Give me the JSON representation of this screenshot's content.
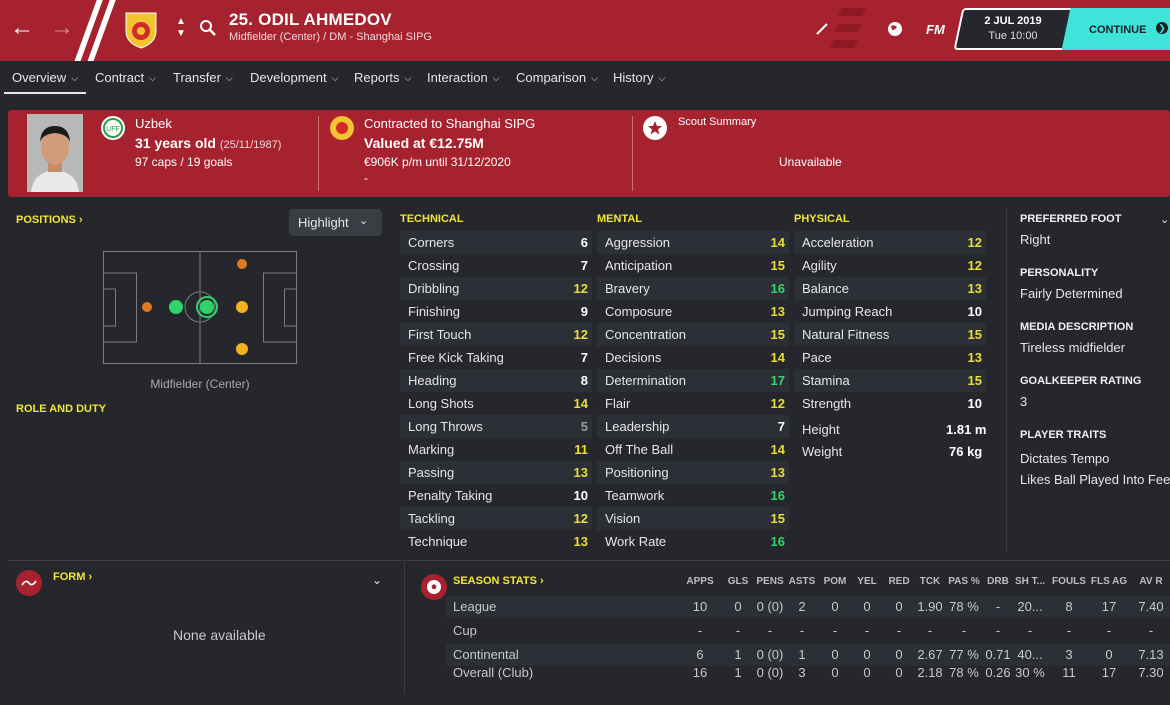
{
  "header": {
    "player_name": "25. ODIL AHMEDOV",
    "player_subtitle": "Midfielder (Center) / DM - Shanghai SIPG",
    "logo": "FM",
    "date": "2 JUL 2019",
    "day_time": "Tue 10:00",
    "continue_label": "CONTINUE"
  },
  "tabs": [
    {
      "label": "Overview"
    },
    {
      "label": "Contract"
    },
    {
      "label": "Transfer"
    },
    {
      "label": "Development"
    },
    {
      "label": "Reports"
    },
    {
      "label": "Interaction"
    },
    {
      "label": "Comparison"
    },
    {
      "label": "History"
    }
  ],
  "banner": {
    "nationality": "Uzbek",
    "age": "31 years old",
    "dob": "(25/11/1987)",
    "caps": "97 caps / 19 goals",
    "contract": "Contracted to Shanghai SIPG",
    "value": "Valued at €12.75M",
    "wage": "€906K p/m until 31/12/2020",
    "dash": "-",
    "scout_title": "Scout Summary",
    "scout_value": "Unavailable"
  },
  "left": {
    "positions_label": "POSITIONS",
    "highlight_label": "Highlight",
    "position_name": "Midfielder (Center)",
    "role_label": "ROLE AND DUTY"
  },
  "attributes": {
    "technical": {
      "title": "TECHNICAL",
      "rows": [
        {
          "name": "Corners",
          "value": "6"
        },
        {
          "name": "Crossing",
          "value": "7"
        },
        {
          "name": "Dribbling",
          "value": "12"
        },
        {
          "name": "Finishing",
          "value": "9"
        },
        {
          "name": "First Touch",
          "value": "12"
        },
        {
          "name": "Free Kick Taking",
          "value": "7"
        },
        {
          "name": "Heading",
          "value": "8"
        },
        {
          "name": "Long Shots",
          "value": "14"
        },
        {
          "name": "Long Throws",
          "value": "5"
        },
        {
          "name": "Marking",
          "value": "11"
        },
        {
          "name": "Passing",
          "value": "13"
        },
        {
          "name": "Penalty Taking",
          "value": "10"
        },
        {
          "name": "Tackling",
          "value": "12"
        },
        {
          "name": "Technique",
          "value": "13"
        }
      ]
    },
    "mental": {
      "title": "MENTAL",
      "rows": [
        {
          "name": "Aggression",
          "value": "14"
        },
        {
          "name": "Anticipation",
          "value": "15"
        },
        {
          "name": "Bravery",
          "value": "16"
        },
        {
          "name": "Composure",
          "value": "13"
        },
        {
          "name": "Concentration",
          "value": "15"
        },
        {
          "name": "Decisions",
          "value": "14"
        },
        {
          "name": "Determination",
          "value": "17"
        },
        {
          "name": "Flair",
          "value": "12"
        },
        {
          "name": "Leadership",
          "value": "7"
        },
        {
          "name": "Off The Ball",
          "value": "14"
        },
        {
          "name": "Positioning",
          "value": "13"
        },
        {
          "name": "Teamwork",
          "value": "16"
        },
        {
          "name": "Vision",
          "value": "15"
        },
        {
          "name": "Work Rate",
          "value": "16"
        }
      ]
    },
    "physical": {
      "title": "PHYSICAL",
      "rows": [
        {
          "name": "Acceleration",
          "value": "12"
        },
        {
          "name": "Agility",
          "value": "12"
        },
        {
          "name": "Balance",
          "value": "13"
        },
        {
          "name": "Jumping Reach",
          "value": "10"
        },
        {
          "name": "Natural Fitness",
          "value": "15"
        },
        {
          "name": "Pace",
          "value": "13"
        },
        {
          "name": "Stamina",
          "value": "15"
        },
        {
          "name": "Strength",
          "value": "10"
        }
      ],
      "height_label": "Height",
      "height_value": "1.81 m",
      "weight_label": "Weight",
      "weight_value": "76 kg"
    }
  },
  "side": {
    "foot_label": "PREFERRED FOOT",
    "foot_value": "Right",
    "personality_label": "PERSONALITY",
    "personality_value": "Fairly Determined",
    "media_label": "MEDIA DESCRIPTION",
    "media_value": "Tireless midfielder",
    "gk_label": "GOALKEEPER RATING",
    "gk_value": "3",
    "traits_label": "PLAYER TRAITS",
    "traits": [
      "Dictates Tempo",
      "Likes Ball Played Into Feet"
    ]
  },
  "form": {
    "title": "FORM",
    "empty": "None available"
  },
  "season_stats": {
    "title": "SEASON STATS",
    "columns": [
      "APPS",
      "GLS",
      "PENS",
      "ASTS",
      "POM",
      "YEL",
      "RED",
      "TCK",
      "PAS %",
      "DRB",
      "SH T...",
      "FOULS",
      "FLS AG",
      "AV R"
    ],
    "rows": [
      {
        "label": "League",
        "cells": [
          "10",
          "0",
          "0 (0)",
          "2",
          "0",
          "0",
          "0",
          "1.90",
          "78 %",
          "-",
          "20...",
          "8",
          "17",
          "7.40"
        ]
      },
      {
        "label": "Cup",
        "cells": [
          "-",
          "-",
          "-",
          "-",
          "-",
          "-",
          "-",
          "-",
          "-",
          "-",
          "-",
          "-",
          "-",
          "-"
        ]
      },
      {
        "label": "Continental",
        "cells": [
          "6",
          "1",
          "0 (0)",
          "1",
          "0",
          "0",
          "0",
          "2.67",
          "77 %",
          "0.71",
          "40...",
          "3",
          "0",
          "7.13"
        ]
      },
      {
        "label": "Overall (Club)",
        "cells": [
          "16",
          "1",
          "0 (0)",
          "3",
          "0",
          "0",
          "0",
          "2.18",
          "78 %",
          "0.26",
          "30 %",
          "11",
          "17",
          "7.30"
        ]
      }
    ]
  }
}
